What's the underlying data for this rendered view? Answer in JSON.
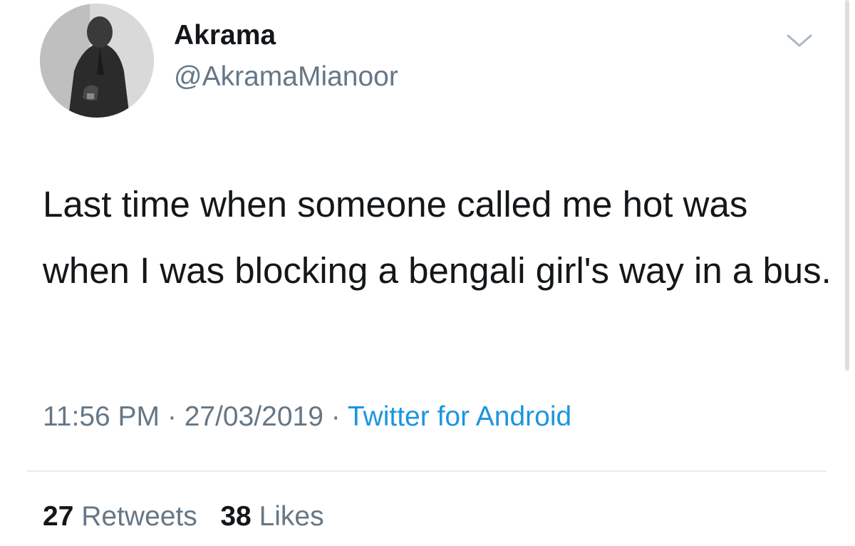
{
  "user": {
    "display_name": "Akrama",
    "handle": "@AkramaMianoor",
    "avatar_icon": "profile-photo"
  },
  "menu": {
    "caret_icon": "chevron-down-icon"
  },
  "tweet": {
    "text": "Last time when someone called me hot was when I was blocking a bengali girl's way in a bus."
  },
  "meta": {
    "time": "11:56 PM",
    "separator1": " · ",
    "date": "27/03/2019",
    "separator2": " · ",
    "source": "Twitter for Android"
  },
  "stats": {
    "retweets_count": "27",
    "retweets_label": "Retweets",
    "likes_count": "38",
    "likes_label": "Likes"
  },
  "colors": {
    "text": "#14171a",
    "secondary": "#657786",
    "link": "#1b95e0",
    "divider": "#e6ecf0"
  }
}
